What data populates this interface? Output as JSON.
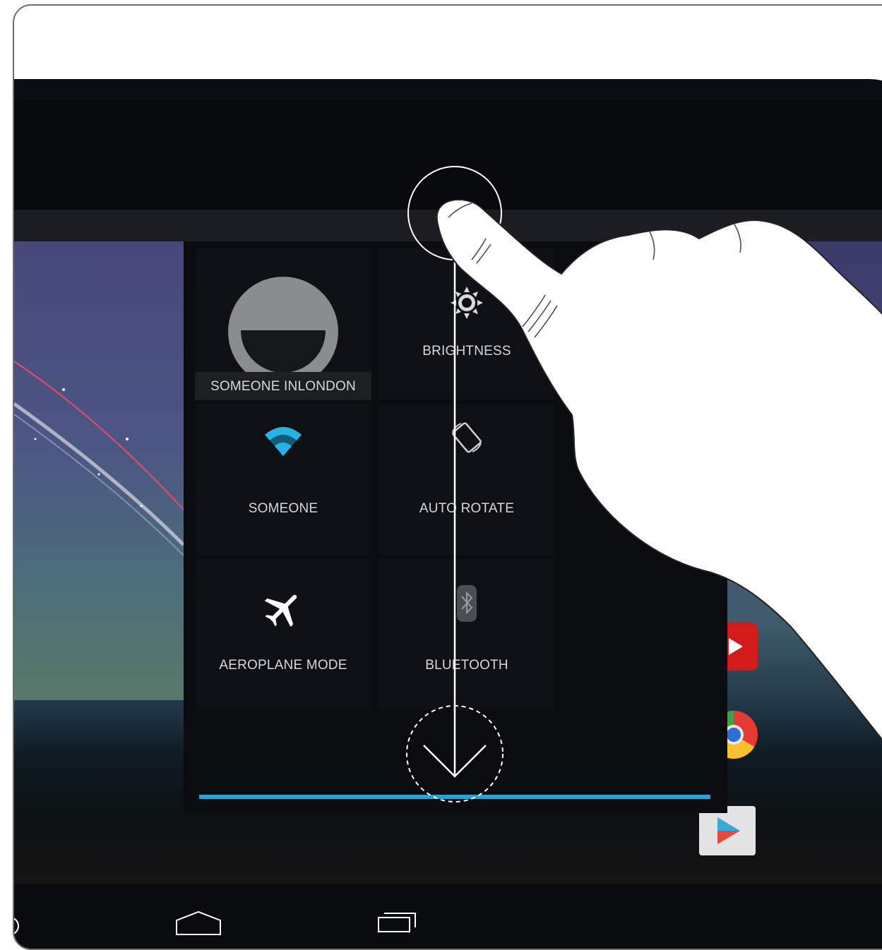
{
  "quick_settings": {
    "user_label": "SOMEONE INLONDON",
    "brightness_label": "BRIGHTNESS",
    "wifi_label": "SOMEONE",
    "rotate_label": "AUTO ROTATE",
    "airplane_label": "AEROPLANE MODE",
    "bluetooth_label": "BLUETOOTH"
  },
  "colors": {
    "accent": "#1aa9dd",
    "panel_bg": "#0a0c10",
    "bezel": "#0b0d12"
  },
  "gesture": {
    "type": "swipe-down",
    "icon": "finger-tap-icon"
  },
  "navbar": {
    "icons": [
      "back-icon",
      "home-icon",
      "recents-icon"
    ]
  },
  "dock": {
    "icons": [
      "youtube-icon",
      "chrome-icon",
      "play-store-icon"
    ]
  }
}
